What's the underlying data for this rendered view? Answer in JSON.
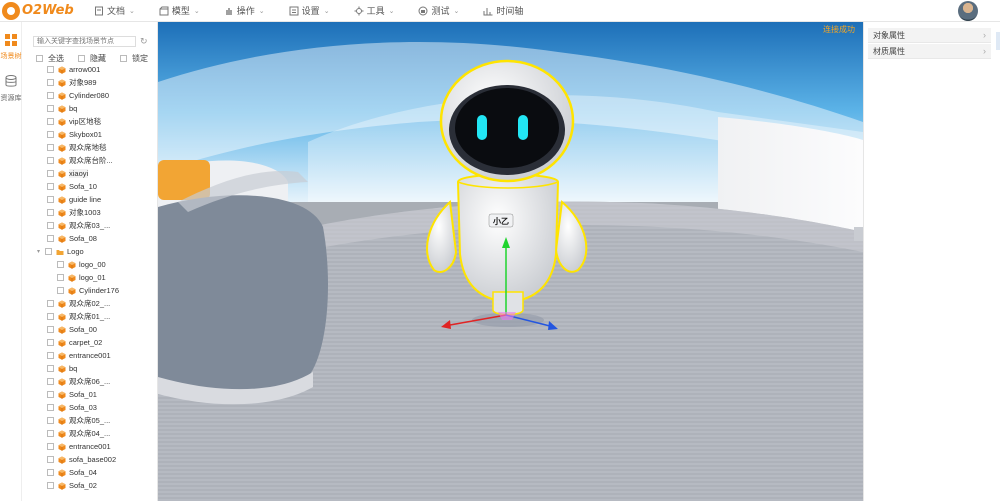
{
  "app": {
    "logo_text": "O2Web",
    "connection_status": "连接成功"
  },
  "menu": [
    {
      "label": "文档",
      "icon": "document-icon"
    },
    {
      "label": "模型",
      "icon": "model-icon"
    },
    {
      "label": "操作",
      "icon": "operation-icon"
    },
    {
      "label": "设置",
      "icon": "settings-icon"
    },
    {
      "label": "工具",
      "icon": "tools-icon"
    },
    {
      "label": "测试",
      "icon": "test-icon"
    },
    {
      "label": "时间轴",
      "icon": "timeline-icon"
    }
  ],
  "rail": {
    "scene_tree_label": "场景树",
    "resource_label": "资源库"
  },
  "tree_panel": {
    "search_placeholder": "输入关键字查找场景节点",
    "filter_select_all": "全选",
    "filter_hide": "隐藏",
    "filter_lock": "锁定",
    "nodes": [
      {
        "label": "arrow001",
        "depth": 0
      },
      {
        "label": "对象989",
        "depth": 0
      },
      {
        "label": "Cylinder080",
        "depth": 0
      },
      {
        "label": "bq",
        "depth": 0
      },
      {
        "label": "vip区地毯",
        "depth": 0
      },
      {
        "label": "Skybox01",
        "depth": 0
      },
      {
        "label": "观众席地毯",
        "depth": 0
      },
      {
        "label": "观众席台阶...",
        "depth": 0
      },
      {
        "label": "xiaoyi",
        "depth": 0,
        "highlight": true
      },
      {
        "label": "Sofa_10",
        "depth": 0
      },
      {
        "label": "guide line",
        "depth": 0
      },
      {
        "label": "对象1003",
        "depth": 0
      },
      {
        "label": "观众席03_...",
        "depth": 0
      },
      {
        "label": "Sofa_08",
        "depth": 0
      },
      {
        "label": "Logo",
        "depth": 0,
        "folder": true
      },
      {
        "label": "logo_00",
        "depth": 1
      },
      {
        "label": "logo_01",
        "depth": 1
      },
      {
        "label": "Cylinder176",
        "depth": 1
      },
      {
        "label": "观众席02_...",
        "depth": 0
      },
      {
        "label": "观众席01_...",
        "depth": 0
      },
      {
        "label": "Sofa_00",
        "depth": 0
      },
      {
        "label": "carpet_02",
        "depth": 0
      },
      {
        "label": "entrance001",
        "depth": 0
      },
      {
        "label": "bq",
        "depth": 0
      },
      {
        "label": "观众席06_...",
        "depth": 0
      },
      {
        "label": "Sofa_01",
        "depth": 0
      },
      {
        "label": "Sofa_03",
        "depth": 0
      },
      {
        "label": "观众席05_...",
        "depth": 0
      },
      {
        "label": "观众席04_...",
        "depth": 0
      },
      {
        "label": "entrance001",
        "depth": 0
      },
      {
        "label": "sofa_base002",
        "depth": 0
      },
      {
        "label": "Sofa_04",
        "depth": 0
      },
      {
        "label": "Sofa_02",
        "depth": 0
      }
    ]
  },
  "viewport": {
    "robot_badge_text": "小乙"
  },
  "props_panel": {
    "object_props_label": "对象属性",
    "material_props_label": "材质属性"
  },
  "colors": {
    "accent": "#f08a1c",
    "status": "#f5a623",
    "selection_outline": "#ffe400"
  }
}
